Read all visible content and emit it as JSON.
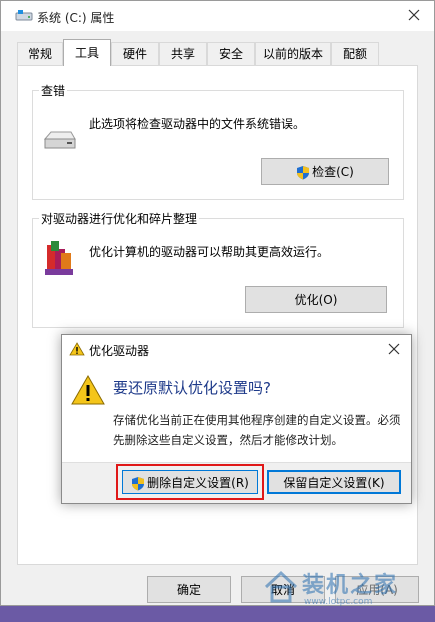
{
  "window": {
    "title": "系统 (C:) 属性",
    "close_glyph": "✕"
  },
  "tabs": [
    {
      "label": "常规"
    },
    {
      "label": "工具"
    },
    {
      "label": "硬件"
    },
    {
      "label": "共享"
    },
    {
      "label": "安全"
    },
    {
      "label": "以前的版本"
    },
    {
      "label": "配额"
    }
  ],
  "active_tab": "工具",
  "error_checking": {
    "group_label": "查错",
    "description": "此选项将检查驱动器中的文件系统错误。",
    "button_label": "检查(C)"
  },
  "optimize": {
    "group_label": "对驱动器进行优化和碎片整理",
    "description": "优化计算机的驱动器可以帮助其更高效运行。",
    "button_label": "优化(O)"
  },
  "dialog": {
    "title": "优化驱动器",
    "close_glyph": "✕",
    "heading": "要还原默认优化设置吗?",
    "message": "存储优化当前正在使用其他程序创建的自定义设置。必须先删除这些自定义设置，然后才能修改计划。",
    "delete_button_label": "删除自定义设置(R)",
    "keep_button_label": "保留自定义设置(K)"
  },
  "footer": {
    "ok_label": "确定",
    "cancel_label": "取消",
    "apply_label": "应用(A)"
  },
  "watermark": {
    "big_text": "装机之家",
    "small_text": "www.lotpc.com"
  },
  "colors": {
    "accent_blue": "#0078d7",
    "highlight_red": "#e01818",
    "desktop_purple": "#6b5aa5"
  }
}
